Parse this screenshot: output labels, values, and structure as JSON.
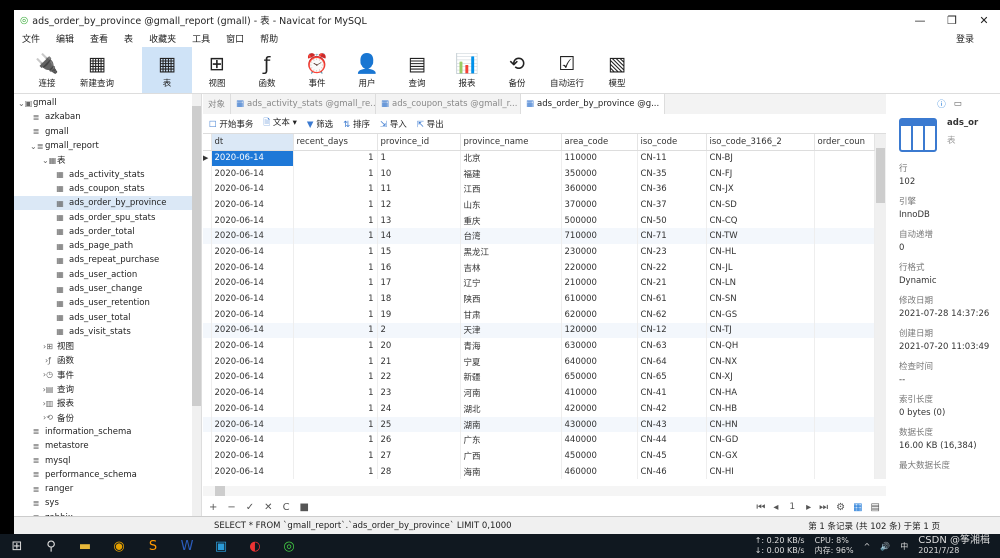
{
  "window": {
    "title": "ads_order_by_province @gmall_report (gmall) - 表 - Navicat for MySQL"
  },
  "menu": [
    "文件",
    "编辑",
    "查看",
    "表",
    "收藏夹",
    "工具",
    "窗口",
    "帮助"
  ],
  "login": "登录",
  "toolbar": [
    {
      "label": "连接",
      "icon": "plug-icon",
      "g": "🔌"
    },
    {
      "label": "新建查询",
      "icon": "new-query-icon",
      "g": "▦"
    },
    {
      "label": "表",
      "icon": "table-icon",
      "g": "▦",
      "active": true
    },
    {
      "label": "视图",
      "icon": "view-icon",
      "g": "⊞"
    },
    {
      "label": "函数",
      "icon": "function-icon",
      "g": "ƒ"
    },
    {
      "label": "事件",
      "icon": "clock-icon",
      "g": "⏰"
    },
    {
      "label": "用户",
      "icon": "user-icon",
      "g": "👤"
    },
    {
      "label": "查询",
      "icon": "query-icon",
      "g": "▤"
    },
    {
      "label": "报表",
      "icon": "report-icon",
      "g": "📊"
    },
    {
      "label": "备份",
      "icon": "backup-icon",
      "g": "⟲"
    },
    {
      "label": "自动运行",
      "icon": "auto-run-icon",
      "g": "☑"
    },
    {
      "label": "模型",
      "icon": "model-icon",
      "g": "▧"
    }
  ],
  "tree": [
    {
      "label": "gmall",
      "lvl": 0,
      "icon": "⌄▣"
    },
    {
      "label": "azkaban",
      "lvl": 1,
      "icon": "≣"
    },
    {
      "label": "gmall",
      "lvl": 1,
      "icon": "≣"
    },
    {
      "label": "gmall_report",
      "lvl": 1,
      "icon": "⌄≣"
    },
    {
      "label": "表",
      "lvl": 2,
      "icon": "⌄▦"
    },
    {
      "label": "ads_activity_stats",
      "lvl": 3,
      "icon": "▦"
    },
    {
      "label": "ads_coupon_stats",
      "lvl": 3,
      "icon": "▦"
    },
    {
      "label": "ads_order_by_province",
      "lvl": 3,
      "icon": "▦",
      "sel": true
    },
    {
      "label": "ads_order_spu_stats",
      "lvl": 3,
      "icon": "▦"
    },
    {
      "label": "ads_order_total",
      "lvl": 3,
      "icon": "▦"
    },
    {
      "label": "ads_page_path",
      "lvl": 3,
      "icon": "▦"
    },
    {
      "label": "ads_repeat_purchase",
      "lvl": 3,
      "icon": "▦"
    },
    {
      "label": "ads_user_action",
      "lvl": 3,
      "icon": "▦"
    },
    {
      "label": "ads_user_change",
      "lvl": 3,
      "icon": "▦"
    },
    {
      "label": "ads_user_retention",
      "lvl": 3,
      "icon": "▦"
    },
    {
      "label": "ads_user_total",
      "lvl": 3,
      "icon": "▦"
    },
    {
      "label": "ads_visit_stats",
      "lvl": 3,
      "icon": "▦"
    },
    {
      "label": "视图",
      "lvl": 2,
      "icon": "›⊞"
    },
    {
      "label": "函数",
      "lvl": 2,
      "icon": "›ƒ"
    },
    {
      "label": "事件",
      "lvl": 2,
      "icon": "›◷"
    },
    {
      "label": "查询",
      "lvl": 2,
      "icon": "›▤"
    },
    {
      "label": "报表",
      "lvl": 2,
      "icon": "›▥"
    },
    {
      "label": "备份",
      "lvl": 2,
      "icon": "›⟲"
    },
    {
      "label": "information_schema",
      "lvl": 1,
      "icon": "≣"
    },
    {
      "label": "metastore",
      "lvl": 1,
      "icon": "≣"
    },
    {
      "label": "mysql",
      "lvl": 1,
      "icon": "≣"
    },
    {
      "label": "performance_schema",
      "lvl": 1,
      "icon": "≣"
    },
    {
      "label": "ranger",
      "lvl": 1,
      "icon": "≣"
    },
    {
      "label": "sys",
      "lvl": 1,
      "icon": "≣"
    },
    {
      "label": "zabbix",
      "lvl": 1,
      "icon": "≣"
    }
  ],
  "tabs": [
    {
      "label": "对象"
    },
    {
      "label": "ads_activity_stats @gmall_re..."
    },
    {
      "label": "ads_coupon_stats @gmall_r..."
    },
    {
      "label": "ads_order_by_province @g...",
      "active": true
    }
  ],
  "subtoolbar": [
    "开始事务",
    "文本 ▾",
    "筛选",
    "排序",
    "导入",
    "导出"
  ],
  "columns": [
    "dt",
    "recent_days",
    "province_id",
    "province_name",
    "area_code",
    "iso_code",
    "iso_code_3166_2",
    "order_coun"
  ],
  "rows": [
    [
      "2020-06-14",
      "1",
      "1",
      "北京",
      "110000",
      "CN-11",
      "CN-BJ",
      ""
    ],
    [
      "2020-06-14",
      "1",
      "10",
      "福建",
      "350000",
      "CN-35",
      "CN-FJ",
      ""
    ],
    [
      "2020-06-14",
      "1",
      "11",
      "江西",
      "360000",
      "CN-36",
      "CN-JX",
      ""
    ],
    [
      "2020-06-14",
      "1",
      "12",
      "山东",
      "370000",
      "CN-37",
      "CN-SD",
      ""
    ],
    [
      "2020-06-14",
      "1",
      "13",
      "重庆",
      "500000",
      "CN-50",
      "CN-CQ",
      ""
    ],
    [
      "2020-06-14",
      "1",
      "14",
      "台湾",
      "710000",
      "CN-71",
      "CN-TW",
      ""
    ],
    [
      "2020-06-14",
      "1",
      "15",
      "黑龙江",
      "230000",
      "CN-23",
      "CN-HL",
      ""
    ],
    [
      "2020-06-14",
      "1",
      "16",
      "吉林",
      "220000",
      "CN-22",
      "CN-JL",
      ""
    ],
    [
      "2020-06-14",
      "1",
      "17",
      "辽宁",
      "210000",
      "CN-21",
      "CN-LN",
      ""
    ],
    [
      "2020-06-14",
      "1",
      "18",
      "陕西",
      "610000",
      "CN-61",
      "CN-SN",
      ""
    ],
    [
      "2020-06-14",
      "1",
      "19",
      "甘肃",
      "620000",
      "CN-62",
      "CN-GS",
      ""
    ],
    [
      "2020-06-14",
      "1",
      "2",
      "天津",
      "120000",
      "CN-12",
      "CN-TJ",
      ""
    ],
    [
      "2020-06-14",
      "1",
      "20",
      "青海",
      "630000",
      "CN-63",
      "CN-QH",
      ""
    ],
    [
      "2020-06-14",
      "1",
      "21",
      "宁夏",
      "640000",
      "CN-64",
      "CN-NX",
      ""
    ],
    [
      "2020-06-14",
      "1",
      "22",
      "新疆",
      "650000",
      "CN-65",
      "CN-XJ",
      ""
    ],
    [
      "2020-06-14",
      "1",
      "23",
      "河南",
      "410000",
      "CN-41",
      "CN-HA",
      ""
    ],
    [
      "2020-06-14",
      "1",
      "24",
      "湖北",
      "420000",
      "CN-42",
      "CN-HB",
      ""
    ],
    [
      "2020-06-14",
      "1",
      "25",
      "湖南",
      "430000",
      "CN-43",
      "CN-HN",
      ""
    ],
    [
      "2020-06-14",
      "1",
      "26",
      "广东",
      "440000",
      "CN-44",
      "CN-GD",
      ""
    ],
    [
      "2020-06-14",
      "1",
      "27",
      "广西",
      "450000",
      "CN-45",
      "CN-GX",
      ""
    ],
    [
      "2020-06-14",
      "1",
      "28",
      "海南",
      "460000",
      "CN-46",
      "CN-HI",
      ""
    ]
  ],
  "nav": {
    "page": "1"
  },
  "info": {
    "name": "ads_or",
    "type": "表",
    "props": [
      {
        "k": "行",
        "v": "102"
      },
      {
        "k": "引擎",
        "v": "InnoDB"
      },
      {
        "k": "自动递增",
        "v": "0"
      },
      {
        "k": "行格式",
        "v": "Dynamic"
      },
      {
        "k": "修改日期",
        "v": "2021-07-28 14:37:26"
      },
      {
        "k": "创建日期",
        "v": "2021-07-20 11:03:49"
      },
      {
        "k": "检查时间",
        "v": "--"
      },
      {
        "k": "索引长度",
        "v": "0 bytes (0)"
      },
      {
        "k": "数据长度",
        "v": "16.00 KB (16,384)"
      },
      {
        "k": "最大数据长度",
        "v": ""
      }
    ]
  },
  "status": {
    "sql": "SELECT * FROM `gmall_report`.`ads_order_by_province` LIMIT 0,1000",
    "records": "第 1 条记录 (共 102 条) 于第 1 页"
  },
  "taskbar": {
    "up": "↑: 0.20 KB/s",
    "down": "↓: 0.00 KB/s",
    "cpu": "CPU: 8%",
    "mem": "内存: 96%",
    "ime": "中",
    "date": "2021/7/28",
    "watermark": "CSDN @筝湘楫"
  },
  "colors": {
    "accent": "#1e78d7",
    "selection": "#dbe8f6"
  }
}
